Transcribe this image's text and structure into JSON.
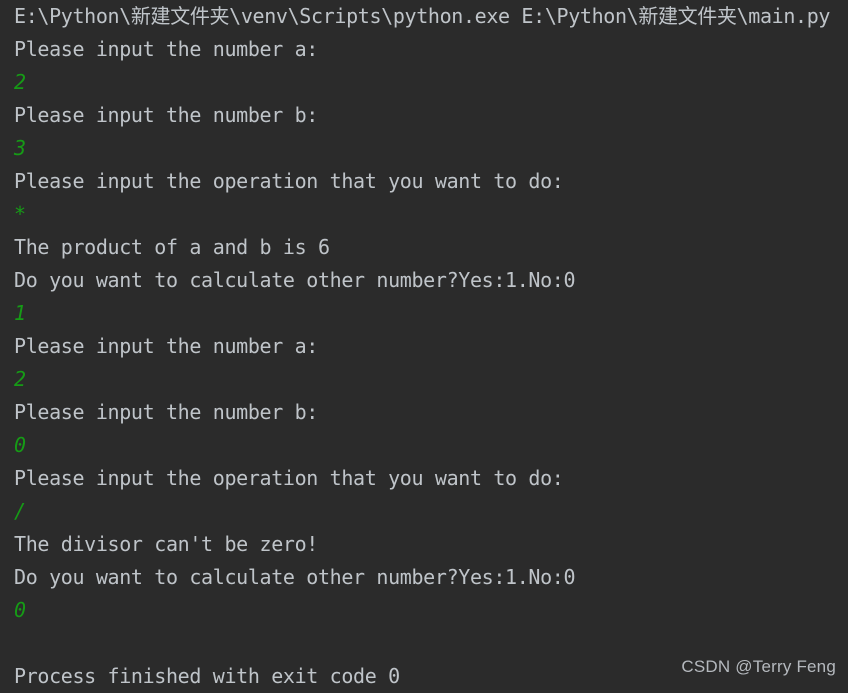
{
  "console": {
    "background_color": "#2b2b2b",
    "output_text_color": "#bfc4c9",
    "input_echo_color": "#169b16",
    "lines": [
      {
        "kind": "output",
        "text": "E:\\Python\\新建文件夹\\venv\\Scripts\\python.exe E:\\Python\\新建文件夹\\main.py"
      },
      {
        "kind": "output",
        "text": "Please input the number a:"
      },
      {
        "kind": "input",
        "text": "2"
      },
      {
        "kind": "output",
        "text": "Please input the number b:"
      },
      {
        "kind": "input",
        "text": "3"
      },
      {
        "kind": "output",
        "text": "Please input the operation that you want to do:"
      },
      {
        "kind": "input",
        "text": "*"
      },
      {
        "kind": "output",
        "text": "The product of a and b is 6"
      },
      {
        "kind": "output",
        "text": "Do you want to calculate other number?Yes:1.No:0"
      },
      {
        "kind": "input",
        "text": "1"
      },
      {
        "kind": "output",
        "text": "Please input the number a:"
      },
      {
        "kind": "input",
        "text": "2"
      },
      {
        "kind": "output",
        "text": "Please input the number b:"
      },
      {
        "kind": "input",
        "text": "0"
      },
      {
        "kind": "output",
        "text": "Please input the operation that you want to do:"
      },
      {
        "kind": "input",
        "text": "/"
      },
      {
        "kind": "output",
        "text": "The divisor can't be zero!"
      },
      {
        "kind": "output",
        "text": "Do you want to calculate other number?Yes:1.No:0"
      },
      {
        "kind": "input",
        "text": "0"
      },
      {
        "kind": "blank",
        "text": " "
      },
      {
        "kind": "output",
        "text": "Process finished with exit code 0"
      }
    ]
  },
  "watermark": {
    "text": "CSDN @Terry Feng"
  }
}
